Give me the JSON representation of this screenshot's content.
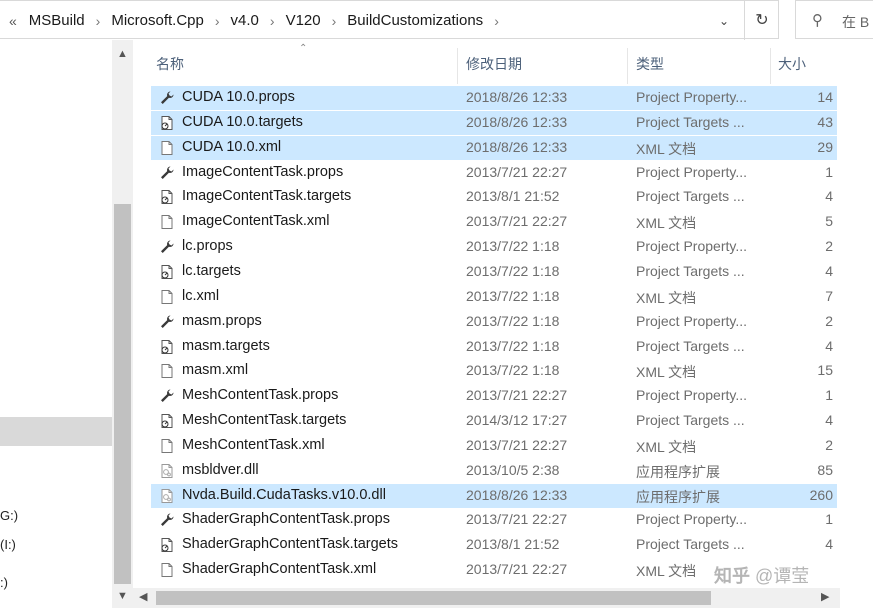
{
  "address": {
    "lead": "«",
    "crumbs": [
      "MSBuild",
      "Microsoft.Cpp",
      "v4.0",
      "V120",
      "BuildCustomizations"
    ],
    "separator": "›",
    "dropdown_icon": "chevron-down",
    "refresh_icon": "refresh"
  },
  "search": {
    "placeholder": "在 B"
  },
  "nav": {
    "fragments": [
      "G:)",
      "(I:)",
      ":)"
    ]
  },
  "columns": {
    "name": "名称",
    "date": "修改日期",
    "type": "类型",
    "size": "大小"
  },
  "files": [
    {
      "name": "CUDA 10.0.props",
      "date": "2018/8/26 12:33",
      "type": "Project Property...",
      "size": "14",
      "icon": "props",
      "selected": true
    },
    {
      "name": "CUDA 10.0.targets",
      "date": "2018/8/26 12:33",
      "type": "Project Targets ...",
      "size": "43",
      "icon": "targets",
      "selected": true
    },
    {
      "name": "CUDA 10.0.xml",
      "date": "2018/8/26 12:33",
      "type": "XML 文档",
      "size": "29",
      "icon": "xml",
      "selected": true
    },
    {
      "name": "ImageContentTask.props",
      "date": "2013/7/21 22:27",
      "type": "Project Property...",
      "size": "1",
      "icon": "props",
      "selected": false
    },
    {
      "name": "ImageContentTask.targets",
      "date": "2013/8/1 21:52",
      "type": "Project Targets ...",
      "size": "4",
      "icon": "targets",
      "selected": false
    },
    {
      "name": "ImageContentTask.xml",
      "date": "2013/7/21 22:27",
      "type": "XML 文档",
      "size": "5",
      "icon": "xml",
      "selected": false
    },
    {
      "name": "lc.props",
      "date": "2013/7/22 1:18",
      "type": "Project Property...",
      "size": "2",
      "icon": "props",
      "selected": false
    },
    {
      "name": "lc.targets",
      "date": "2013/7/22 1:18",
      "type": "Project Targets ...",
      "size": "4",
      "icon": "targets",
      "selected": false
    },
    {
      "name": "lc.xml",
      "date": "2013/7/22 1:18",
      "type": "XML 文档",
      "size": "7",
      "icon": "xml",
      "selected": false
    },
    {
      "name": "masm.props",
      "date": "2013/7/22 1:18",
      "type": "Project Property...",
      "size": "2",
      "icon": "props",
      "selected": false
    },
    {
      "name": "masm.targets",
      "date": "2013/7/22 1:18",
      "type": "Project Targets ...",
      "size": "4",
      "icon": "targets",
      "selected": false
    },
    {
      "name": "masm.xml",
      "date": "2013/7/22 1:18",
      "type": "XML 文档",
      "size": "15",
      "icon": "xml",
      "selected": false
    },
    {
      "name": "MeshContentTask.props",
      "date": "2013/7/21 22:27",
      "type": "Project Property...",
      "size": "1",
      "icon": "props",
      "selected": false
    },
    {
      "name": "MeshContentTask.targets",
      "date": "2014/3/12 17:27",
      "type": "Project Targets ...",
      "size": "4",
      "icon": "targets",
      "selected": false
    },
    {
      "name": "MeshContentTask.xml",
      "date": "2013/7/21 22:27",
      "type": "XML 文档",
      "size": "2",
      "icon": "xml",
      "selected": false
    },
    {
      "name": "msbldver.dll",
      "date": "2013/10/5 2:38",
      "type": "应用程序扩展",
      "size": "85",
      "icon": "dll",
      "selected": false
    },
    {
      "name": "Nvda.Build.CudaTasks.v10.0.dll",
      "date": "2018/8/26 12:33",
      "type": "应用程序扩展",
      "size": "260",
      "icon": "dll",
      "selected": true
    },
    {
      "name": "ShaderGraphContentTask.props",
      "date": "2013/7/21 22:27",
      "type": "Project Property...",
      "size": "1",
      "icon": "props",
      "selected": false
    },
    {
      "name": "ShaderGraphContentTask.targets",
      "date": "2013/8/1 21:52",
      "type": "Project Targets ...",
      "size": "4",
      "icon": "targets",
      "selected": false
    },
    {
      "name": "ShaderGraphContentTask.xml",
      "date": "2013/7/21 22:27",
      "type": "XML 文档",
      "size": "",
      "icon": "xml",
      "selected": false
    }
  ],
  "watermark": {
    "logo": "知乎",
    "handle": "@谭莹"
  },
  "colors": {
    "selection": "#cce8ff",
    "header_text": "#4c607a",
    "secondary_text": "#6d6d6d"
  }
}
